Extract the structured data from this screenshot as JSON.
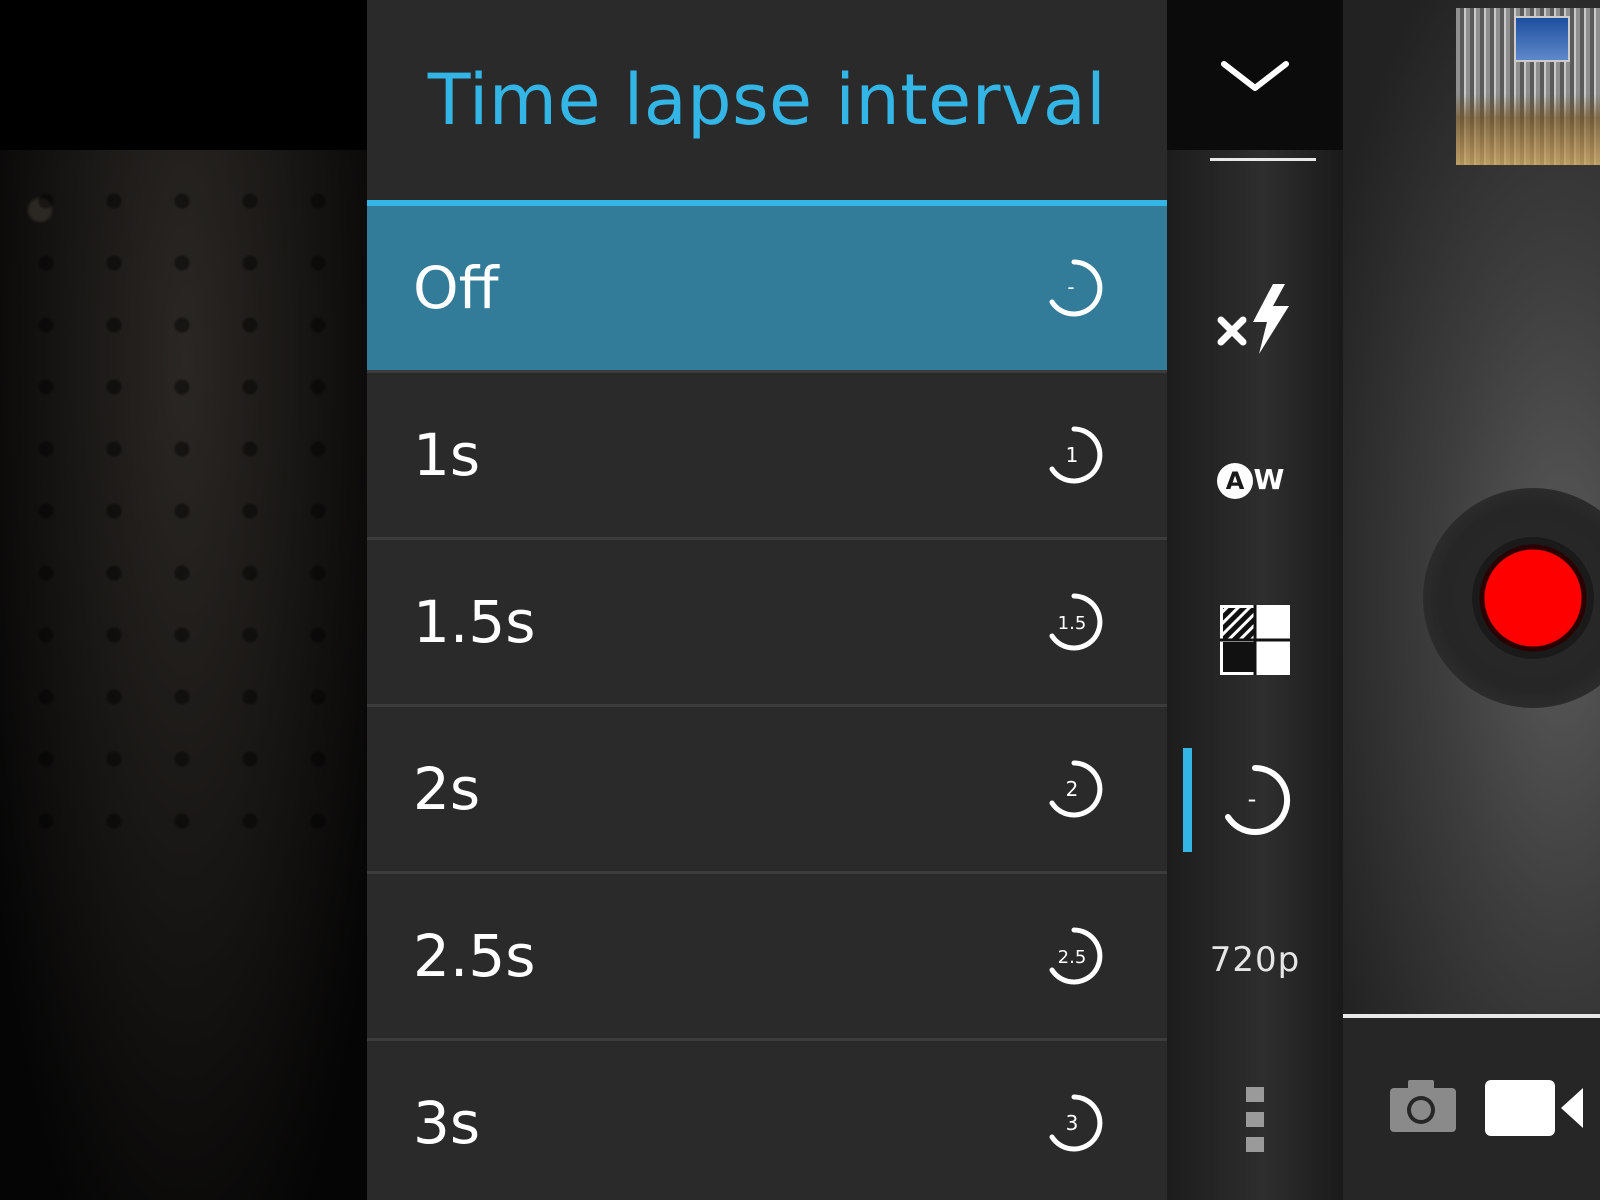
{
  "dialog": {
    "title": "Time lapse interval",
    "options": [
      {
        "label": "Off",
        "icon_text": "-",
        "selected": true
      },
      {
        "label": "1s",
        "icon_text": "1",
        "selected": false
      },
      {
        "label": "1.5s",
        "icon_text": "1.5",
        "selected": false
      },
      {
        "label": "2s",
        "icon_text": "2",
        "selected": false
      },
      {
        "label": "2.5s",
        "icon_text": "2.5",
        "selected": false
      },
      {
        "label": "3s",
        "icon_text": "3",
        "selected": false
      }
    ]
  },
  "controls": {
    "collapse_icon": "chevron-down-icon",
    "flash_icon": "flash-off-icon",
    "white_balance_icon": "auto-white-balance-icon",
    "white_balance_text": "AW",
    "exposure_icon": "grid-pattern-icon",
    "timer_icon": "time-lapse-icon",
    "timer_text": "-",
    "resolution": "720p",
    "more_icon": "more-vertical-icon"
  },
  "mode_switch": {
    "photo_icon": "camera-icon",
    "video_icon": "video-camera-icon",
    "active": "video"
  },
  "colors": {
    "accent": "#33b5e5",
    "selected_row": "#327c99",
    "record": "#ff0000",
    "panel": "#2a2a2a"
  }
}
